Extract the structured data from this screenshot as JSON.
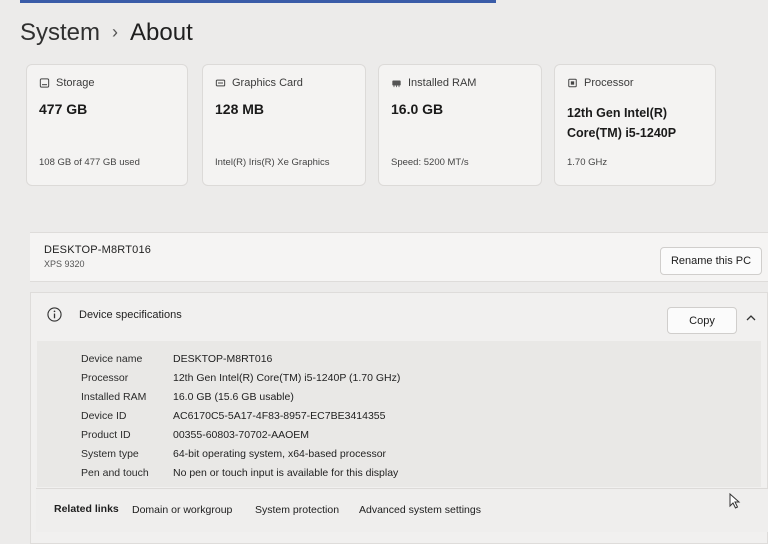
{
  "breadcrumb": {
    "parent": "System",
    "separator": "›",
    "current": "About"
  },
  "cards": [
    {
      "label": "Storage",
      "value": "477 GB",
      "sub": "108 GB of 477 GB used",
      "icon": "storage-icon"
    },
    {
      "label": "Graphics Card",
      "value": "128 MB",
      "sub": "Intel(R) Iris(R) Xe Graphics",
      "icon": "graphics-card-icon"
    },
    {
      "label": "Installed RAM",
      "value": "16.0 GB",
      "sub": "Speed: 5200 MT/s",
      "icon": "ram-icon"
    },
    {
      "label": "Processor",
      "value": "12th Gen Intel(R) Core(TM) i5-1240P",
      "sub": "1.70 GHz",
      "icon": "processor-icon"
    }
  ],
  "pc": {
    "name": "DESKTOP-M8RT016",
    "model": "XPS 9320",
    "rename_label": "Rename this PC"
  },
  "specs": {
    "title": "Device specifications",
    "copy_label": "Copy",
    "rows": [
      {
        "label": "Device name",
        "value": "DESKTOP-M8RT016"
      },
      {
        "label": "Processor",
        "value": "12th Gen Intel(R) Core(TM) i5-1240P (1.70 GHz)"
      },
      {
        "label": "Installed RAM",
        "value": "16.0 GB (15.6 GB usable)"
      },
      {
        "label": "Device ID",
        "value": "AC6170C5-5A17-4F83-8957-EC7BE3414355"
      },
      {
        "label": "Product ID",
        "value": "00355-60803-70702-AAOEM"
      },
      {
        "label": "System type",
        "value": "64-bit operating system, x64-based processor"
      },
      {
        "label": "Pen and touch",
        "value": "No pen or touch input is available for this display"
      }
    ]
  },
  "related": {
    "label": "Related links",
    "links": [
      "Domain or workgroup",
      "System protection",
      "Advanced system settings"
    ]
  },
  "colors": {
    "accent": "#3a5ca8",
    "background": "#ecebea",
    "card": "#f4f3f2"
  }
}
